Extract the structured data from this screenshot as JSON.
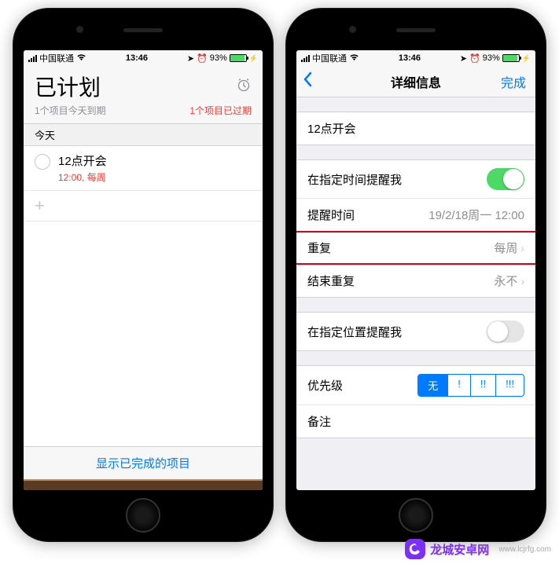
{
  "status": {
    "carrier": "中国联通",
    "time": "13:46",
    "battery_pct": "93%"
  },
  "left": {
    "title": "已计划",
    "subtitle_left": "1个项目今天到期",
    "subtitle_right": "1个项目已过期",
    "section": "今天",
    "item": {
      "title": "12点开会",
      "detail": "12:00,  每周"
    },
    "footer_link": "显示已完成的项目"
  },
  "right": {
    "nav_title": "详细信息",
    "nav_done": "完成",
    "task_title": "12点开会",
    "remind_time_label": "在指定时间提醒我",
    "alarm_time_label": "提醒时间",
    "alarm_time_value": "19/2/18周一 12:00",
    "repeat_label": "重复",
    "repeat_value": "每周",
    "end_repeat_label": "结束重复",
    "end_repeat_value": "永不",
    "remind_loc_label": "在指定位置提醒我",
    "priority_label": "优先级",
    "priority_opts": [
      "无",
      "!",
      "!!",
      "!!!"
    ],
    "notes_label": "备注"
  },
  "watermark": {
    "brand": "龙城安卓网",
    "url": "www.lcjrfg.com"
  }
}
